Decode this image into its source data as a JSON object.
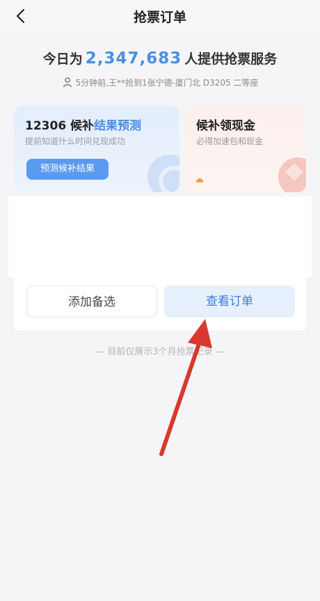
{
  "header": {
    "title": "抢票订单"
  },
  "stats": {
    "prefix": "今日为",
    "count": "2,347,683",
    "suffix": "人提供抢票服务"
  },
  "ticker": {
    "text": "5分钟前,王**抢到1张宁德-厦门北 D3205 二等座"
  },
  "cards": {
    "predict": {
      "title_prefix": "12306 候补",
      "title_highlight": "结果预测",
      "subtitle": "提前知道什么时间兑现成功",
      "button": "预测候补结果"
    },
    "cash": {
      "title": "候补领现金",
      "subtitle": "必得加速包和现金"
    }
  },
  "actions": {
    "add_label": "添加备选",
    "view_label": "查看订单"
  },
  "footer": {
    "note": "— 目前仅展示3个月抢票记录 —"
  },
  "colors": {
    "accent": "#4a8fe3",
    "arrow": "#d9382e"
  }
}
